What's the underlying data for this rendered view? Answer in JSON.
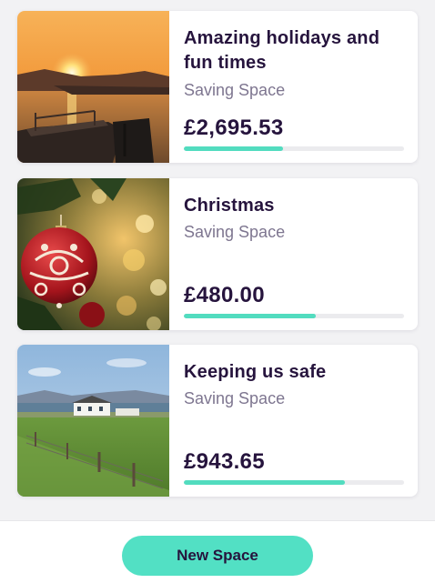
{
  "spaces": [
    {
      "title": "Amazing holidays and fun times",
      "subtitle": "Saving Space",
      "amount": "£2,695.53",
      "progress": 0.45,
      "image": "sunset-harbour-boat-photo"
    },
    {
      "title": "Christmas",
      "subtitle": "Saving Space",
      "amount": "£480.00",
      "progress": 0.6,
      "image": "christmas-bauble-photo"
    },
    {
      "title": "Keeping us safe",
      "subtitle": "Saving Space",
      "amount": "£943.65",
      "progress": 0.73,
      "image": "coastal-farmhouse-field-photo"
    }
  ],
  "footer": {
    "new_space_label": "New Space"
  },
  "colors": {
    "accent": "#52e0c4",
    "progress_fill": "#52dcbf",
    "progress_track": "#ebebee",
    "text_primary": "#26143d",
    "text_secondary": "#7e7690",
    "background": "#f2f2f4"
  }
}
